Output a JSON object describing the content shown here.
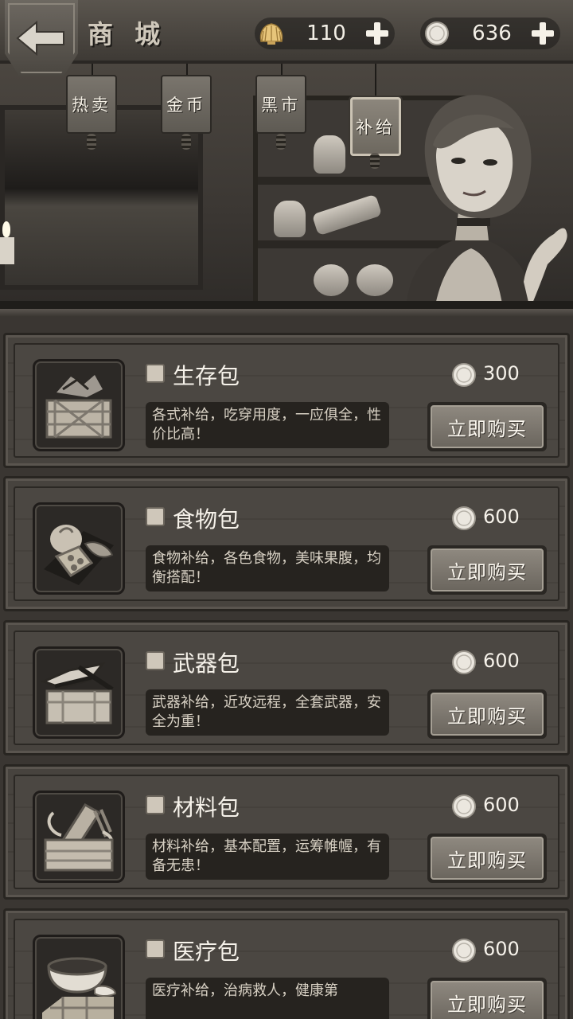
{
  "header": {
    "title": "商 城",
    "back_icon": "arrow-left-icon",
    "currencies": [
      {
        "icon": "shell-icon",
        "value": "110"
      },
      {
        "icon": "coin-icon",
        "value": "636"
      }
    ]
  },
  "tabs": [
    {
      "label": "热卖",
      "active": false
    },
    {
      "label": "金币",
      "active": false
    },
    {
      "label": "黑市",
      "active": false
    },
    {
      "label": "补给",
      "active": true
    }
  ],
  "items": [
    {
      "name": "生存包",
      "desc": "各式补给，吃穿用度，一应俱全，性价比高！",
      "price": "300",
      "button": "立即购买",
      "icon": "survival-box-icon"
    },
    {
      "name": "食物包",
      "desc": "食物补给，各色食物，美味果腹，均衡搭配！",
      "price": "600",
      "button": "立即购买",
      "icon": "food-icon"
    },
    {
      "name": "武器包",
      "desc": "武器补给，近攻远程，全套武器，安全为重！",
      "price": "600",
      "button": "立即购买",
      "icon": "weapon-box-icon"
    },
    {
      "name": "材料包",
      "desc": "材料补给，基本配置，运筹帷幄，有备无患！",
      "price": "600",
      "button": "立即购买",
      "icon": "material-box-icon"
    },
    {
      "name": "医疗包",
      "desc": "医疗补给，治病救人，健康第",
      "price": "600",
      "button": "立即购买",
      "icon": "medical-bowl-icon"
    }
  ]
}
